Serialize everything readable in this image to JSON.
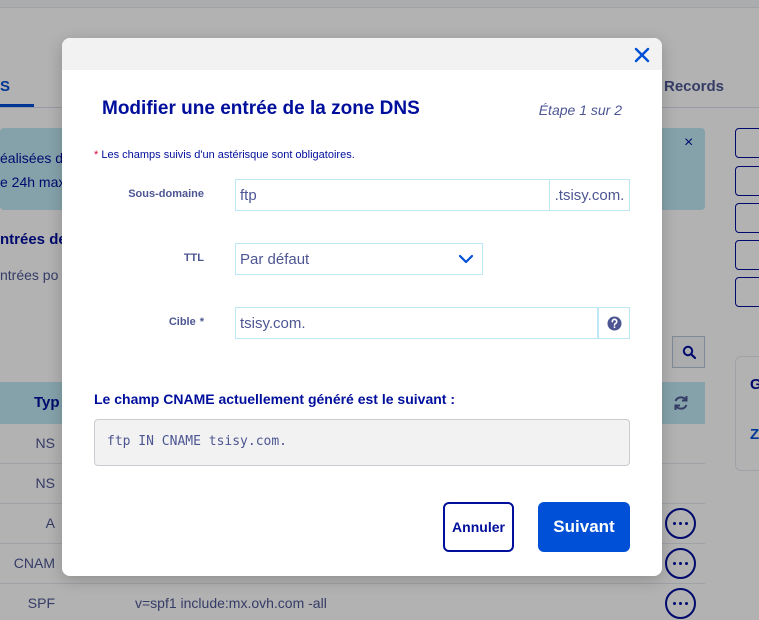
{
  "background": {
    "tab_left": "S",
    "tab_right": "Records",
    "info_line_1": "éalisées da",
    "info_line_2": "e 24h max",
    "info_close": "×",
    "section_title": "ntrées de",
    "section_subtitle": "ntrées po",
    "panel_letter_1": "G",
    "panel_letter_2": "Z",
    "table_header_type": "Typ",
    "rows": [
      {
        "type": "NS",
        "value": ""
      },
      {
        "type": "NS",
        "value": ""
      },
      {
        "type": "A",
        "value": ""
      },
      {
        "type": "CNAM",
        "value": ""
      },
      {
        "type": "SPF",
        "value": "v=spf1 include:mx.ovh.com -all"
      }
    ]
  },
  "modal": {
    "title": "Modifier une entrée de la zone DNS",
    "step": "Étape 1 sur 2",
    "required_star": "*",
    "required_note": "Les champs suivis d'un astérisque sont obligatoires.",
    "subdomain": {
      "label": "Sous-domaine",
      "value": "ftp",
      "suffix": ".tsisy.com."
    },
    "ttl": {
      "label": "TTL",
      "selected": "Par défaut"
    },
    "target": {
      "label": "Cible",
      "star": "*",
      "value": "tsisy.com."
    },
    "cname_title": "Le champ CNAME actuellement généré est le suivant :",
    "cname_value": "ftp IN CNAME tsisy.com.",
    "cancel_label": "Annuler",
    "next_label": "Suivant"
  },
  "colors": {
    "primary": "#000e9c",
    "accent": "#0050d7",
    "info_bg": "#bfe8f5",
    "required_star": "#d3003b"
  },
  "icons": [
    "close-icon",
    "chevron-down-icon",
    "help-icon",
    "search-icon",
    "refresh-icon",
    "more-options-icon"
  ]
}
